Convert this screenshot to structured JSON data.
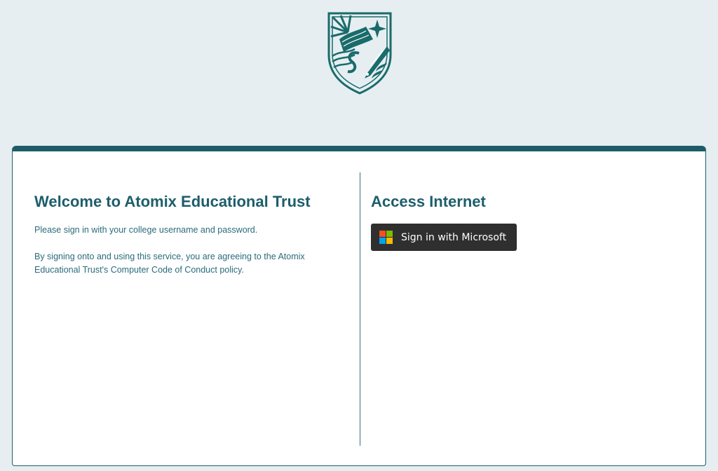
{
  "logo": {
    "icon": "shield-crest-icon",
    "color": "#1a6b6b"
  },
  "left_panel": {
    "title": "Welcome to Atomix Educational Trust",
    "instruction": "Please sign in with your college username and password.",
    "policy_notice": "By signing onto and using this service, you are agreeing to the Atomix Educational Trust's Computer Code of Conduct policy."
  },
  "right_panel": {
    "title": "Access Internet",
    "signin_button": {
      "label": "Sign in with Microsoft",
      "icon": "microsoft-logo-icon"
    }
  },
  "colors": {
    "page_background": "#e6eef1",
    "heading": "#1d5e6b",
    "card_top_bar": "#1c5c68",
    "button_background": "#2f2f2f",
    "ms_red": "#f25022",
    "ms_green": "#7fba00",
    "ms_blue": "#00a4ef",
    "ms_yellow": "#ffb900"
  }
}
